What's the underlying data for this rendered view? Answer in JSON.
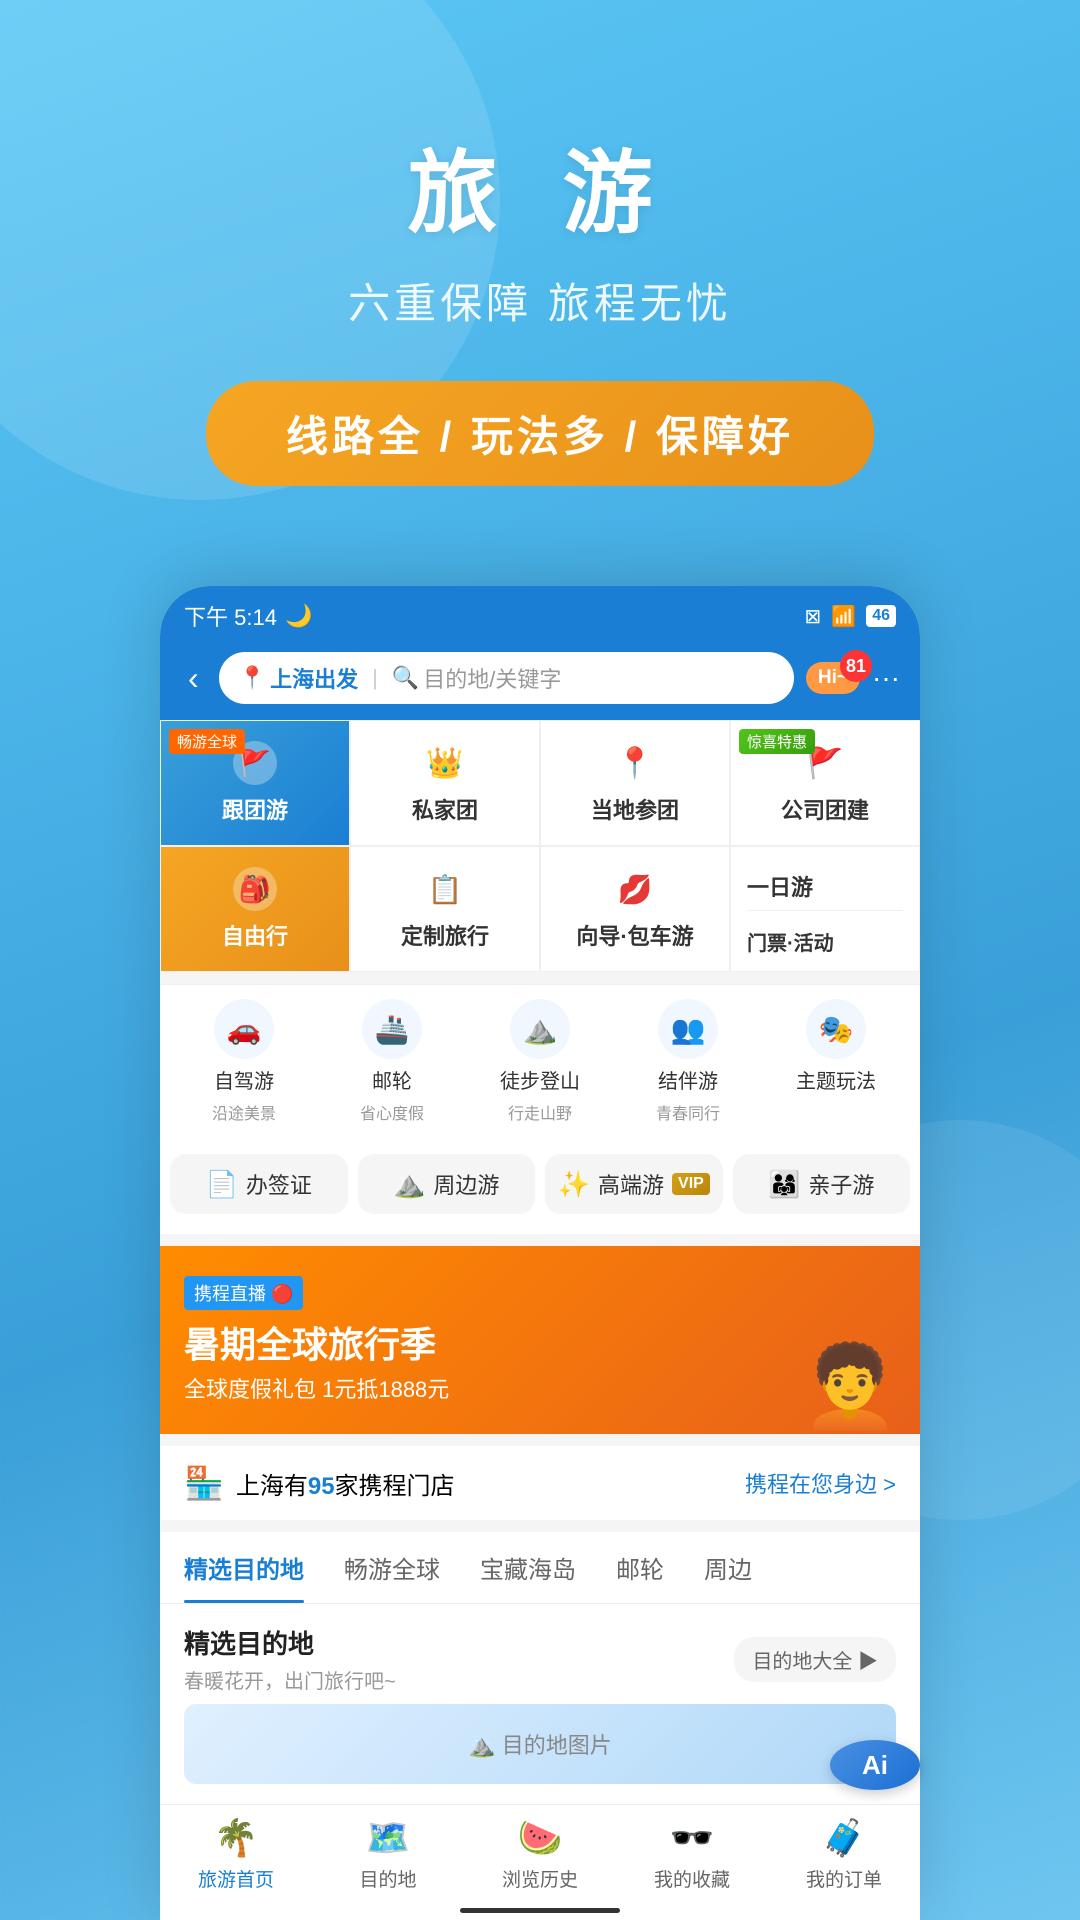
{
  "hero": {
    "title": "旅 游",
    "subtitle": "六重保障 旅程无忧",
    "badge": "线路全 / 玩法多 / 保障好"
  },
  "phone": {
    "statusBar": {
      "time": "下午 5:14",
      "moonIcon": "🌙",
      "wifiIcon": "WiFi",
      "battery": "46"
    },
    "searchBar": {
      "backBtn": "‹",
      "locationIcon": "📍",
      "origin": "上海出发",
      "searchIcon": "🔍",
      "destination": "目的地/关键字",
      "hiLabel": "Hi~",
      "notifCount": "81"
    },
    "categories": {
      "row1": [
        {
          "label": "跟团游",
          "icon": "🚩",
          "highlight": "blue",
          "tag": "畅游全球"
        },
        {
          "label": "私家团",
          "icon": "👑",
          "highlight": "none",
          "tag": ""
        },
        {
          "label": "当地参团",
          "icon": "📍",
          "highlight": "none",
          "tag": ""
        },
        {
          "label": "公司团建",
          "icon": "🚩",
          "highlight": "none",
          "tag": "惊喜特惠"
        }
      ],
      "row2": [
        {
          "label": "自由行",
          "icon": "🎒",
          "highlight": "orange",
          "tag": ""
        },
        {
          "label": "定制旅行",
          "icon": "📋",
          "highlight": "none",
          "tag": ""
        },
        {
          "label": "向导·包车游",
          "icon": "💋",
          "highlight": "none",
          "tag": ""
        },
        {
          "label1": "一日游",
          "label2": "门票·活动",
          "highlight": "none",
          "tag": ""
        }
      ],
      "row3": [
        {
          "main": "自驾游",
          "sub": "沿途美景"
        },
        {
          "main": "邮轮",
          "sub": "省心度假"
        },
        {
          "main": "徒步登山",
          "sub": "行走山野"
        },
        {
          "main": "结伴游",
          "sub": "青春同行"
        },
        {
          "main": "主题玩法",
          "sub": ""
        }
      ]
    },
    "promoItems": [
      {
        "label": "办签证",
        "icon": "📄"
      },
      {
        "label": "周边游",
        "icon": "⛰️"
      },
      {
        "label": "高端游",
        "icon": "VIP",
        "isVip": true
      },
      {
        "label": "亲子游",
        "icon": "👨‍👩‍👧"
      }
    ],
    "banner": {
      "tag": "携程直播",
      "title": "暑期全球旅行季",
      "sub": "全球度假礼包 1元抵1888元"
    },
    "storeInfo": {
      "prefix": "上海有",
      "count": "95",
      "suffix": "家携程门店",
      "link": "携程在您身边 >"
    },
    "tabs": [
      {
        "label": "精选目的地",
        "active": true
      },
      {
        "label": "畅游全球"
      },
      {
        "label": "宝藏海岛"
      },
      {
        "label": "邮轮"
      },
      {
        "label": "周边"
      }
    ],
    "destSection": {
      "title": "精选目的地",
      "sub": "春暖花开，出门旅行吧~",
      "allBtn": "目的地大全 ▶"
    },
    "bottomNav": [
      {
        "icon": "🌴",
        "label": "旅游首页",
        "active": true
      },
      {
        "icon": "🗺️",
        "label": "目的地",
        "active": false
      },
      {
        "icon": "🍉",
        "label": "浏览历史",
        "active": false
      },
      {
        "icon": "🕶️",
        "label": "我的收藏",
        "active": false
      },
      {
        "icon": "🧳",
        "label": "我的订单",
        "active": false
      }
    ]
  },
  "colors": {
    "primary": "#1a7fd4",
    "orange": "#f5a623",
    "red": "#ff3333",
    "bg": "#f5f5f5"
  }
}
